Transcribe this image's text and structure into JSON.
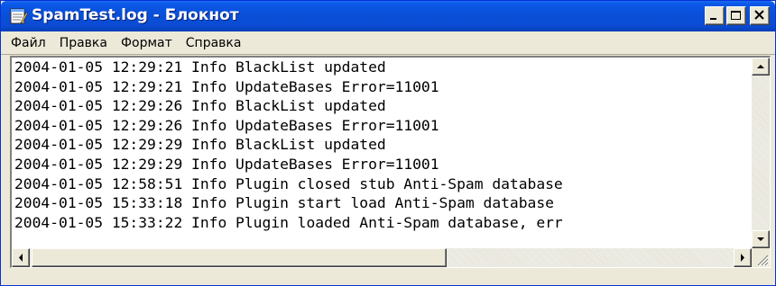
{
  "window": {
    "title": "SpamTest.log - Блокнот",
    "accent_color": "#0a4fd8"
  },
  "caption_buttons": {
    "minimize_icon": "minimize-icon",
    "maximize_icon": "maximize-icon",
    "close_icon": "close-icon"
  },
  "menu": {
    "file": "Файл",
    "edit": "Правка",
    "format": "Формат",
    "help": "Справка"
  },
  "document": {
    "lines": [
      "2004-01-05 12:29:21 Info BlackList updated",
      "2004-01-05 12:29:21 Info UpdateBases Error=11001",
      "2004-01-05 12:29:26 Info BlackList updated",
      "2004-01-05 12:29:26 Info UpdateBases Error=11001",
      "2004-01-05 12:29:29 Info BlackList updated",
      "2004-01-05 12:29:29 Info UpdateBases Error=11001",
      "2004-01-05 12:58:51 Info Plugin closed stub Anti-Spam database",
      "2004-01-05 15:33:18 Info Plugin start load Anti-Spam database",
      "2004-01-05 15:33:22 Info Plugin loaded Anti-Spam database, err"
    ]
  }
}
